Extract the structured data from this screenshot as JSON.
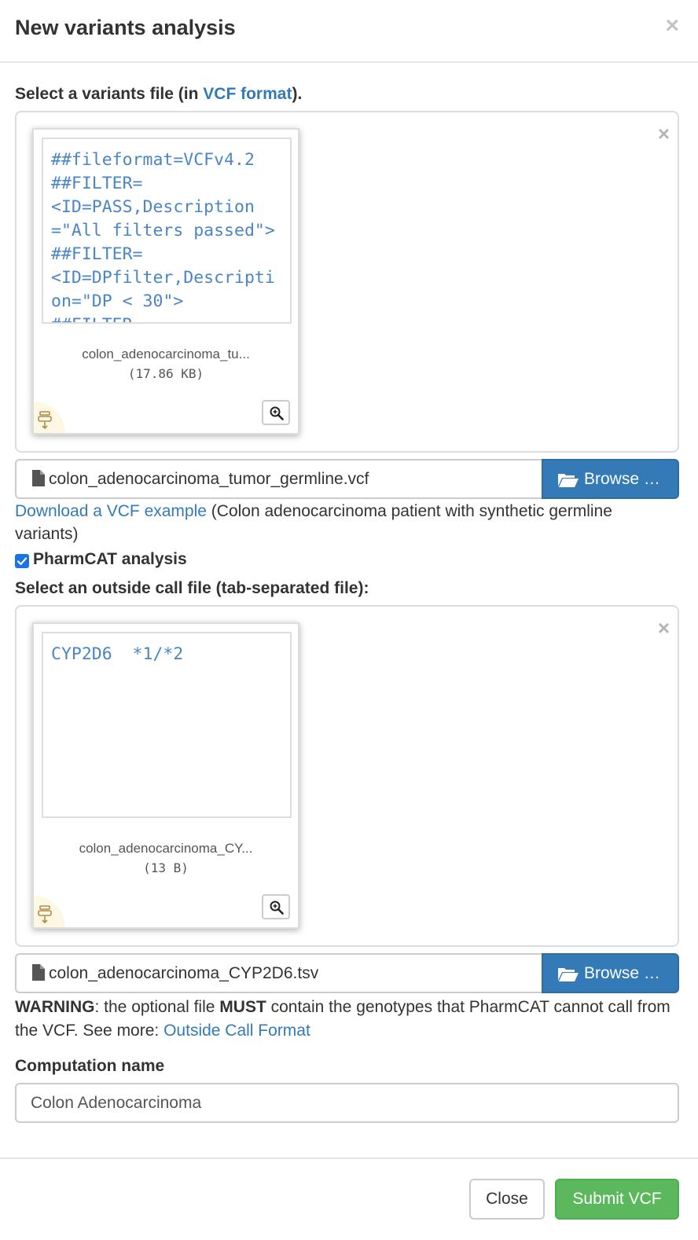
{
  "modal": {
    "title": "New variants analysis",
    "close_symbol": "×"
  },
  "variants": {
    "label_prefix": "Select a variants file (in ",
    "label_link": "VCF format",
    "label_suffix": ").",
    "preview_remove_symbol": "×",
    "preview_text": "##fileformat=VCFv4.2\n##FILTER=\n<ID=PASS,Description=\"All filters passed\">\n##FILTER=\n<ID=DPfilter,Description=\"DP < 30\">\n##FILTER=",
    "thumb_caption": "colon_adenocarcinoma_tu...",
    "thumb_size": "(17.86 KB)",
    "file_name": "colon_adenocarcinoma_tumor_germline.vcf",
    "browse_label": "Browse …",
    "download_link": "Download a VCF example",
    "download_note": " (Colon adenocarcinoma patient with synthetic germline variants)"
  },
  "pharmcat": {
    "checked": true,
    "label": "PharmCAT analysis"
  },
  "outside_call": {
    "label": "Select an outside call file (tab-separated file):",
    "preview_remove_symbol": "×",
    "preview_text": "CYP2D6  *1/*2",
    "thumb_caption": "colon_adenocarcinoma_CY...",
    "thumb_size": "(13 B)",
    "file_name": "colon_adenocarcinoma_CYP2D6.tsv",
    "browse_label": "Browse …",
    "warning_strong": "WARNING",
    "warning_text_1": ": the optional file ",
    "warning_must": "MUST",
    "warning_text_2": " contain the genotypes that PharmCAT cannot call from the VCF. See more: ",
    "warning_link": "Outside Call Format"
  },
  "computation": {
    "label": "Computation name",
    "value": "Colon Adenocarcinoma"
  },
  "footer": {
    "close_label": "Close",
    "submit_label": "Submit VCF"
  },
  "colors": {
    "primary": "#337ab7",
    "success": "#5cb85c",
    "checkbox": "#1a73e8",
    "preview_text": "#4a86c5"
  },
  "icons": {
    "file": "file-icon",
    "folder_open": "folder-open-icon",
    "zoom": "zoom-in-icon",
    "drag": "drag-handle-icon",
    "check": "check-icon"
  }
}
